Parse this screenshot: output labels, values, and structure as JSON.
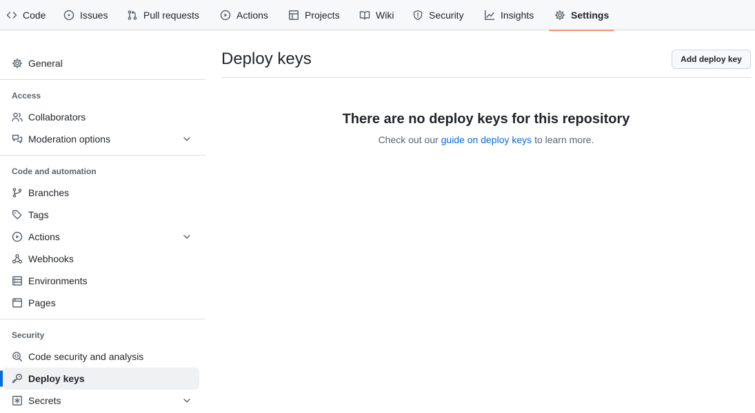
{
  "repo_nav": {
    "tabs": [
      {
        "label": "Code",
        "icon": "code-icon"
      },
      {
        "label": "Issues",
        "icon": "issue-opened-icon"
      },
      {
        "label": "Pull requests",
        "icon": "git-pull-request-icon"
      },
      {
        "label": "Actions",
        "icon": "play-icon"
      },
      {
        "label": "Projects",
        "icon": "table-icon"
      },
      {
        "label": "Wiki",
        "icon": "book-icon"
      },
      {
        "label": "Security",
        "icon": "shield-icon"
      },
      {
        "label": "Insights",
        "icon": "graph-icon"
      },
      {
        "label": "Settings",
        "icon": "gear-icon",
        "selected": true
      }
    ]
  },
  "sidebar": {
    "general": "General",
    "sections": [
      {
        "heading": "Access",
        "items": [
          {
            "label": "Collaborators",
            "icon": "people-icon"
          },
          {
            "label": "Moderation options",
            "icon": "comment-discussion-icon",
            "expandable": true
          }
        ]
      },
      {
        "heading": "Code and automation",
        "items": [
          {
            "label": "Branches",
            "icon": "git-branch-icon"
          },
          {
            "label": "Tags",
            "icon": "tag-icon"
          },
          {
            "label": "Actions",
            "icon": "play-icon",
            "expandable": true
          },
          {
            "label": "Webhooks",
            "icon": "webhook-icon"
          },
          {
            "label": "Environments",
            "icon": "server-icon"
          },
          {
            "label": "Pages",
            "icon": "browser-icon"
          }
        ]
      },
      {
        "heading": "Security",
        "items": [
          {
            "label": "Code security and analysis",
            "icon": "codescan-icon"
          },
          {
            "label": "Deploy keys",
            "icon": "key-icon",
            "active": true
          },
          {
            "label": "Secrets",
            "icon": "key-asterisk-icon",
            "expandable": true
          }
        ]
      }
    ]
  },
  "main": {
    "title": "Deploy keys",
    "add_button": "Add deploy key",
    "blankslate": {
      "heading": "There are no deploy keys for this repository",
      "text_before": "Check out our",
      "link": "guide on deploy keys",
      "text_after": "to learn more."
    }
  },
  "colors": {
    "accent": "#0969da",
    "selected_underline": "#fd8c73",
    "nav_background": "#f6f8fa"
  }
}
